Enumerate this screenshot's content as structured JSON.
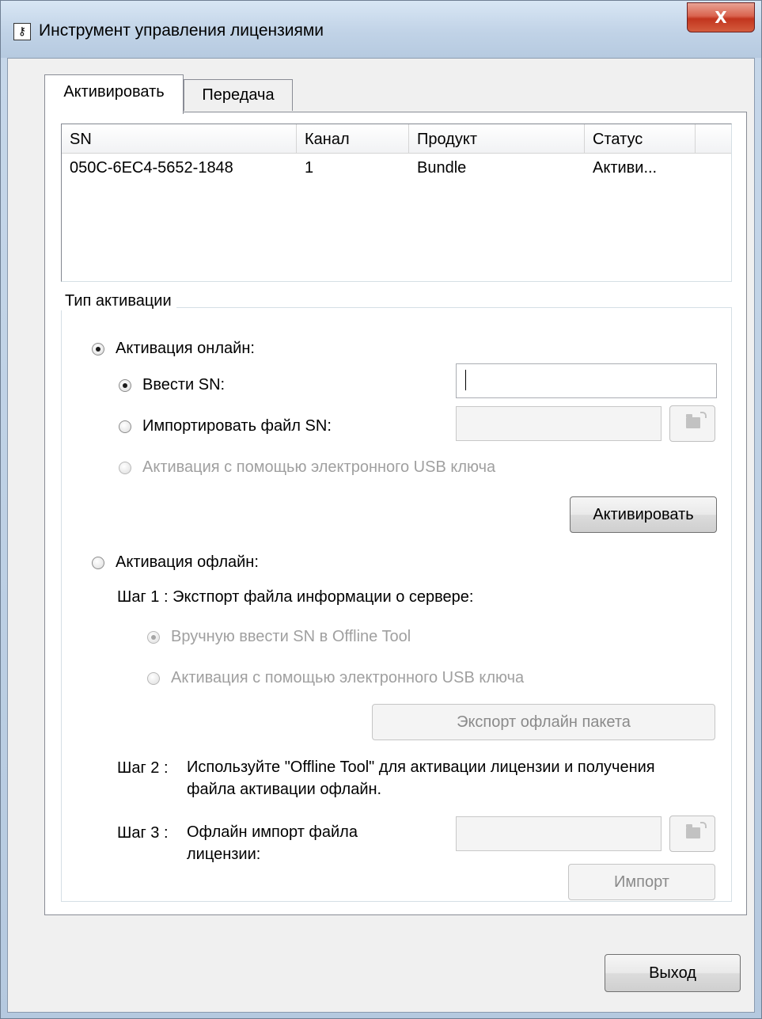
{
  "window": {
    "title": "Инструмент управления лицензиями",
    "close_label": "X"
  },
  "tabs": {
    "activate": "Активировать",
    "transfer": "Передача"
  },
  "licenses": {
    "columns": [
      "SN",
      "Канал",
      "Продукт",
      "Статус"
    ],
    "rows": [
      {
        "sn": "050C-6EC4-5652-1848",
        "channel": "1",
        "product": "Bundle",
        "status": "Активи..."
      }
    ]
  },
  "activation": {
    "group_label": "Тип активации",
    "online": {
      "label": "Активация онлайн:",
      "selected": true,
      "enter_sn": {
        "label": "Ввести SN:",
        "selected": true,
        "value": ""
      },
      "import_sn_file": {
        "label": "Импортировать файл SN:",
        "selected": false,
        "value": ""
      },
      "usb_key": {
        "label": "Активация с помощью электронного USB ключа",
        "selected": false,
        "enabled": false
      },
      "activate_button": "Активировать"
    },
    "offline": {
      "label": "Активация офлайн:",
      "selected": false,
      "step1": {
        "label": "Шаг 1 :  Экстпорт файла информации о сервере:",
        "manual_sn": "Вручную ввести SN в Offline Tool",
        "usb_key": "Активация с помощью электронного USB ключа",
        "export_button": "Экспорт офлайн пакета"
      },
      "step2": {
        "prefix": "Шаг 2 :",
        "text": "Используйте \"Offline Tool\" для активации лицензии и получения файла активации офлайн."
      },
      "step3": {
        "prefix": "Шаг 3 :",
        "text": "Офлайн импорт файла лицензии:",
        "value": "",
        "import_button": "Импорт"
      }
    }
  },
  "footer": {
    "exit_button": "Выход"
  }
}
